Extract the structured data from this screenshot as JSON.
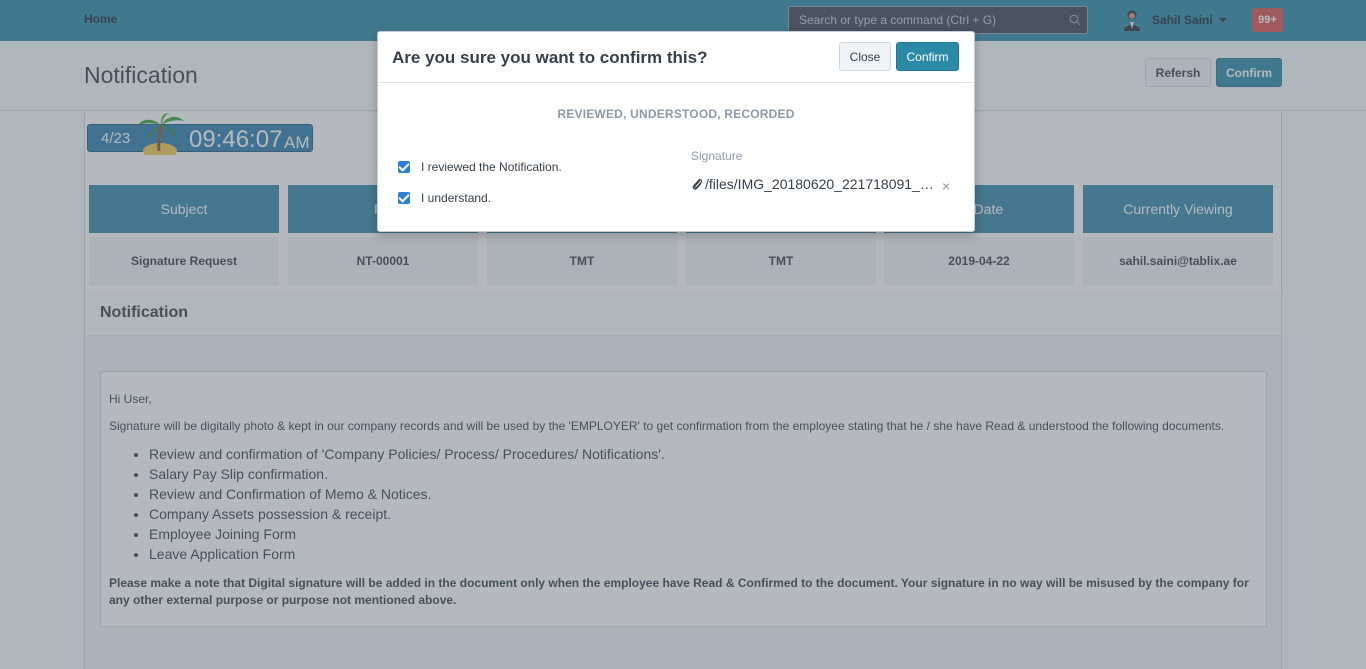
{
  "navbar": {
    "home": "Home",
    "search_placeholder": "Search or type a command (Ctrl + G)",
    "user_name": "Sahil Saini",
    "notifications": "99+"
  },
  "page": {
    "title": "Notification",
    "refresh_label": "Refersh",
    "confirm_label": "Confirm"
  },
  "clock": {
    "date": "4/23",
    "time": "09:46:07",
    "ampm": "AM"
  },
  "info": [
    {
      "header": "Subject",
      "value": "Signature Request"
    },
    {
      "header": "Re",
      "value": "NT-00001"
    },
    {
      "header": "",
      "value": "TMT"
    },
    {
      "header": "",
      "value": "TMT"
    },
    {
      "header": "se Date",
      "value": "2019-04-22"
    },
    {
      "header": "Currently Viewing",
      "value": "sahil.saini@tablix.ae"
    }
  ],
  "section": {
    "title": "Notification"
  },
  "note": {
    "greeting": "Hi User,",
    "intro": "Signature will be digitally photo & kept in our company records and will be used by the 'EMPLOYER' to get confirmation from the employee stating that he / she have Read & understood the following documents.",
    "items": [
      "Review and confirmation of 'Company Policies/ Process/ Procedures/ Notifications'.",
      "Salary Pay Slip confirmation.",
      "Review and Confirmation of Memo & Notices.",
      "Company Assets possession & receipt.",
      "Employee Joining Form",
      "Leave Application Form"
    ],
    "footer": "Please make a note that Digital signature will be added in the document only when the employee have Read & Confirmed to the document. Your signature in no way will be misused by the company for any other external purpose or purpose not mentioned above."
  },
  "modal": {
    "title": "Are you sure you want to confirm this?",
    "close_label": "Close",
    "confirm_label": "Confirm",
    "subheading": "REVIEWED, UNDERSTOOD, RECORDED",
    "checkbox_reviewed": "I reviewed the Notification.",
    "checkbox_understand": "I understand.",
    "signature_label": "Signature",
    "signature_file": "/files/IMG_20180620_221718091_HDR.jpg",
    "remove_symbol": "×"
  },
  "colors": {
    "brand": "#2b8aa6",
    "header_cell": "#3389a8",
    "badge": "#d9534f",
    "checkbox": "#2d7fd5"
  }
}
